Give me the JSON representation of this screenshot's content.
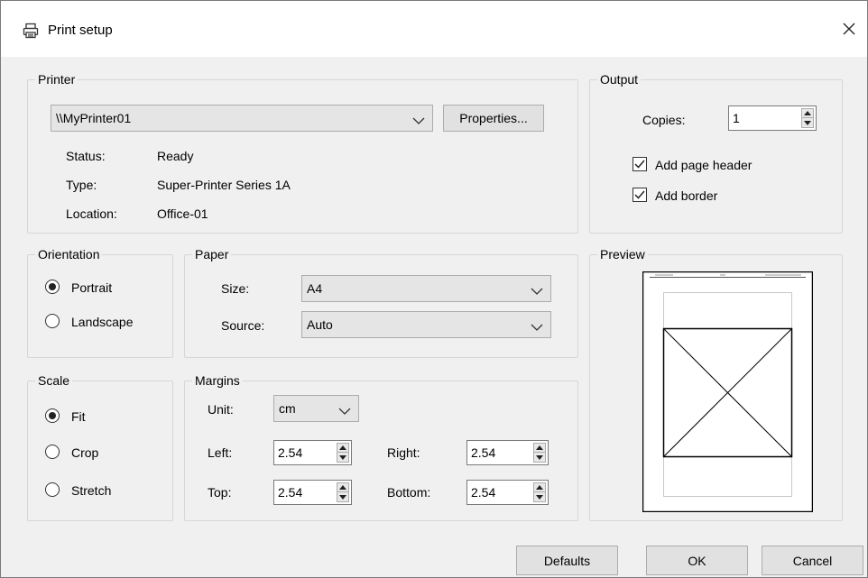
{
  "window": {
    "title": "Print setup",
    "icon": "printer-icon",
    "close_icon": "close-icon"
  },
  "printer": {
    "legend": "Printer",
    "selected": "\\\\MyPrinter01",
    "properties_label": "Properties...",
    "status_label": "Status:",
    "status_value": "Ready",
    "type_label": "Type:",
    "type_value": "Super-Printer Series 1A",
    "location_label": "Location:",
    "location_value": "Office-01"
  },
  "output": {
    "legend": "Output",
    "copies_label": "Copies:",
    "copies_value": "1",
    "add_header_label": "Add page header",
    "add_header_checked": true,
    "add_border_label": "Add border",
    "add_border_checked": true
  },
  "orientation": {
    "legend": "Orientation",
    "options": [
      {
        "label": "Portrait",
        "selected": true
      },
      {
        "label": "Landscape",
        "selected": false
      }
    ]
  },
  "paper": {
    "legend": "Paper",
    "size_label": "Size:",
    "size_value": "A4",
    "source_label": "Source:",
    "source_value": "Auto"
  },
  "preview": {
    "legend": "Preview"
  },
  "scale": {
    "legend": "Scale",
    "options": [
      {
        "label": "Fit",
        "selected": true
      },
      {
        "label": "Crop",
        "selected": false
      },
      {
        "label": "Stretch",
        "selected": false
      }
    ]
  },
  "margins": {
    "legend": "Margins",
    "unit_label": "Unit:",
    "unit_value": "cm",
    "left_label": "Left:",
    "left_value": "2.54",
    "right_label": "Right:",
    "right_value": "2.54",
    "top_label": "Top:",
    "top_value": "2.54",
    "bottom_label": "Bottom:",
    "bottom_value": "2.54"
  },
  "buttons": {
    "defaults": "Defaults",
    "ok": "OK",
    "cancel": "Cancel"
  }
}
